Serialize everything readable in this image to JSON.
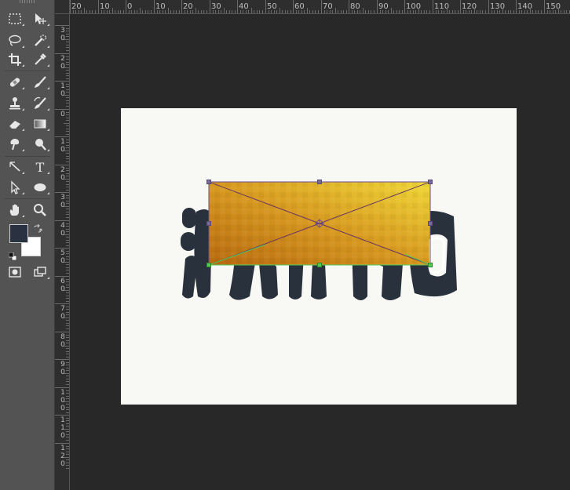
{
  "rulers": {
    "horizontal_labels": [
      "20",
      "10",
      "0",
      "10",
      "20",
      "30",
      "40",
      "50",
      "60",
      "70",
      "80",
      "90",
      "100",
      "110",
      "120",
      "130",
      "140",
      "150"
    ],
    "vertical_labels": [
      "3\n0",
      "2\n0",
      "1\n0",
      "0",
      "1\n0",
      "2\n0",
      "3\n0",
      "4\n0",
      "5\n0",
      "6\n0",
      "7\n0",
      "8\n0",
      "9\n0",
      "1\n0\n0",
      "1\n1\n0",
      "1\n2\n0"
    ]
  },
  "toolbar": {
    "tools": [
      {
        "name": "marquee-tool",
        "icon": "rect-marquee-icon"
      },
      {
        "name": "move-tool",
        "icon": "move-icon"
      },
      {
        "name": "lasso-tool",
        "icon": "lasso-icon"
      },
      {
        "name": "quick-select-tool",
        "icon": "quick-select-icon"
      },
      {
        "name": "crop-tool",
        "icon": "crop-icon"
      },
      {
        "name": "eyedropper-tool",
        "icon": "eyedropper-icon"
      },
      {
        "name": "healing-tool",
        "icon": "bandage-icon"
      },
      {
        "name": "brush-tool",
        "icon": "brush-icon"
      },
      {
        "name": "stamp-tool",
        "icon": "stamp-icon"
      },
      {
        "name": "history-brush-tool",
        "icon": "history-brush-icon"
      },
      {
        "name": "eraser-tool",
        "icon": "eraser-icon"
      },
      {
        "name": "gradient-tool",
        "icon": "gradient-icon"
      },
      {
        "name": "blur-tool",
        "icon": "blur-icon"
      },
      {
        "name": "dodge-tool",
        "icon": "dodge-icon"
      },
      {
        "name": "pen-tool",
        "icon": "pen-icon"
      },
      {
        "name": "type-tool",
        "icon": "type-icon",
        "label": "T"
      },
      {
        "name": "path-select-tool",
        "icon": "arrow-icon"
      },
      {
        "name": "ellipse-tool",
        "icon": "ellipse-icon"
      },
      {
        "name": "hand-tool",
        "icon": "hand-icon"
      },
      {
        "name": "zoom-tool",
        "icon": "zoom-icon"
      }
    ],
    "foreground_color": "#2a3140",
    "background_color": "#ffffff"
  },
  "canvas": {
    "background": "#f8f8f4",
    "text_color": "#28313c",
    "gradient_colors": [
      "#b86a10",
      "#d89a20",
      "#f0d838"
    ],
    "text_glyphs": "深圳任我园"
  }
}
